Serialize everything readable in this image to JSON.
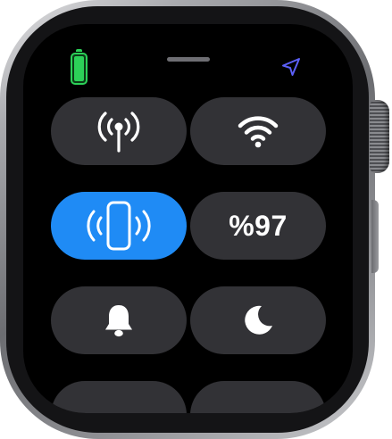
{
  "status": {
    "battery_icon": "battery-full-icon",
    "grabber": "grabber-handle",
    "location_icon": "location-arrow-icon"
  },
  "tiles": {
    "cellular": {
      "icon": "cellular-antenna-icon",
      "active": false
    },
    "wifi": {
      "icon": "wifi-icon",
      "active": false
    },
    "ping_iphone": {
      "icon": "ping-iphone-icon",
      "active": true
    },
    "battery": {
      "label": "%97",
      "percent": 97
    },
    "silent_mode": {
      "icon": "bell-icon",
      "active": false
    },
    "do_not_disturb": {
      "icon": "moon-icon",
      "active": false
    }
  },
  "colors": {
    "tile_background": "#323236",
    "tile_active": "#1f8bf5",
    "battery_green": "#2cd158",
    "location_blue": "#5b5ff6",
    "screen": "#000000"
  }
}
